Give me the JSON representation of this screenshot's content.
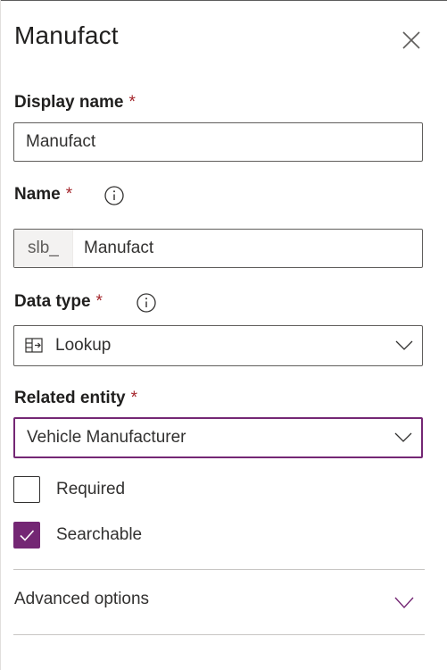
{
  "panel": {
    "title": "Manufact",
    "close_icon": "close-icon"
  },
  "display_name": {
    "label": "Display name",
    "required_mark": "*",
    "value": "Manufact"
  },
  "name": {
    "label": "Name",
    "required_mark": "*",
    "prefix": "slb_",
    "value": "Manufact"
  },
  "data_type": {
    "label": "Data type",
    "required_mark": "*",
    "selected": "Lookup",
    "icon": "lookup-icon"
  },
  "related_entity": {
    "label": "Related entity",
    "required_mark": "*",
    "selected": "Vehicle Manufacturer"
  },
  "options": {
    "required": {
      "label": "Required",
      "checked": false
    },
    "searchable": {
      "label": "Searchable",
      "checked": true
    }
  },
  "advanced": {
    "label": "Advanced options"
  },
  "colors": {
    "accent": "#742774",
    "required": "#a4262c",
    "border": "#605e5c"
  }
}
